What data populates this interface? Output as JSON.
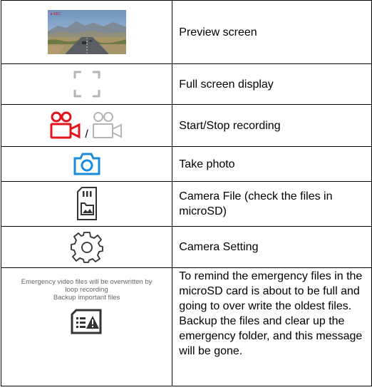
{
  "rows": [
    {
      "icon": "preview-thumbnail",
      "label": "Preview screen",
      "thumb_label": "REC"
    },
    {
      "icon": "fullscreen-icon",
      "label": "Full screen display"
    },
    {
      "icon": "video-camera-icon",
      "label": "Start/Stop recording",
      "separator": "/"
    },
    {
      "icon": "camera-icon",
      "label": "Take photo"
    },
    {
      "icon": "sd-card-file-icon",
      "label": "Camera File (check the files in microSD)"
    },
    {
      "icon": "gear-icon",
      "label": "Camera Setting"
    },
    {
      "icon": "sd-card-warning-icon",
      "warning_lines": [
        "Emergency video files will be overwritten by",
        "loop recording",
        "Backup important files"
      ],
      "label": "To remind the emergency files in the microSD card is about to be full and going to over write the oldest files. Backup the files and clear up the emergency folder, and this message will be gone."
    }
  ],
  "colors": {
    "record_red": "#e3141c",
    "photo_blue": "#1a8bd8",
    "icon_gray": "#b5b5b5",
    "icon_dark": "#333333",
    "warning_text": "#666666"
  }
}
